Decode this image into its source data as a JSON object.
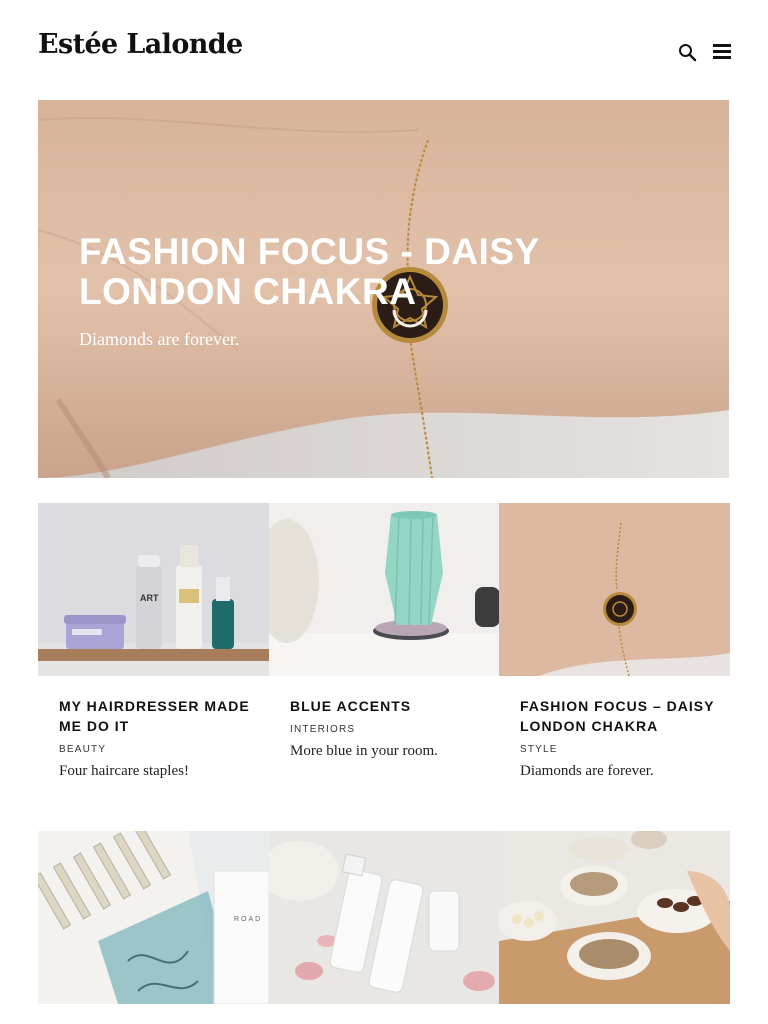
{
  "site": {
    "logo": "Estée Lalonde",
    "search_icon": "search-icon",
    "menu_icon": "hamburger-menu-icon"
  },
  "hero": {
    "title": "FASHION FOCUS - DAISY LONDON CHAKRA",
    "subtitle": "Diamonds are forever."
  },
  "posts": [
    {
      "title": "MY HAIRDRESSER MADE ME DO IT",
      "category": "BEAUTY",
      "description": "Four haircare staples!"
    },
    {
      "title": "BLUE ACCENTS",
      "category": "INTERIORS",
      "description": "More blue in your room."
    },
    {
      "title": "FASHION FOCUS – DAISY LONDON CHAKRA",
      "category": "STYLE",
      "description": "Diamonds are forever."
    }
  ],
  "image_labels": {
    "bottle_text": "ART",
    "perfume_box_text": "ROAD"
  },
  "colors": {
    "text": "#111111",
    "background": "#ffffff",
    "hero_text": "#ffffff"
  }
}
